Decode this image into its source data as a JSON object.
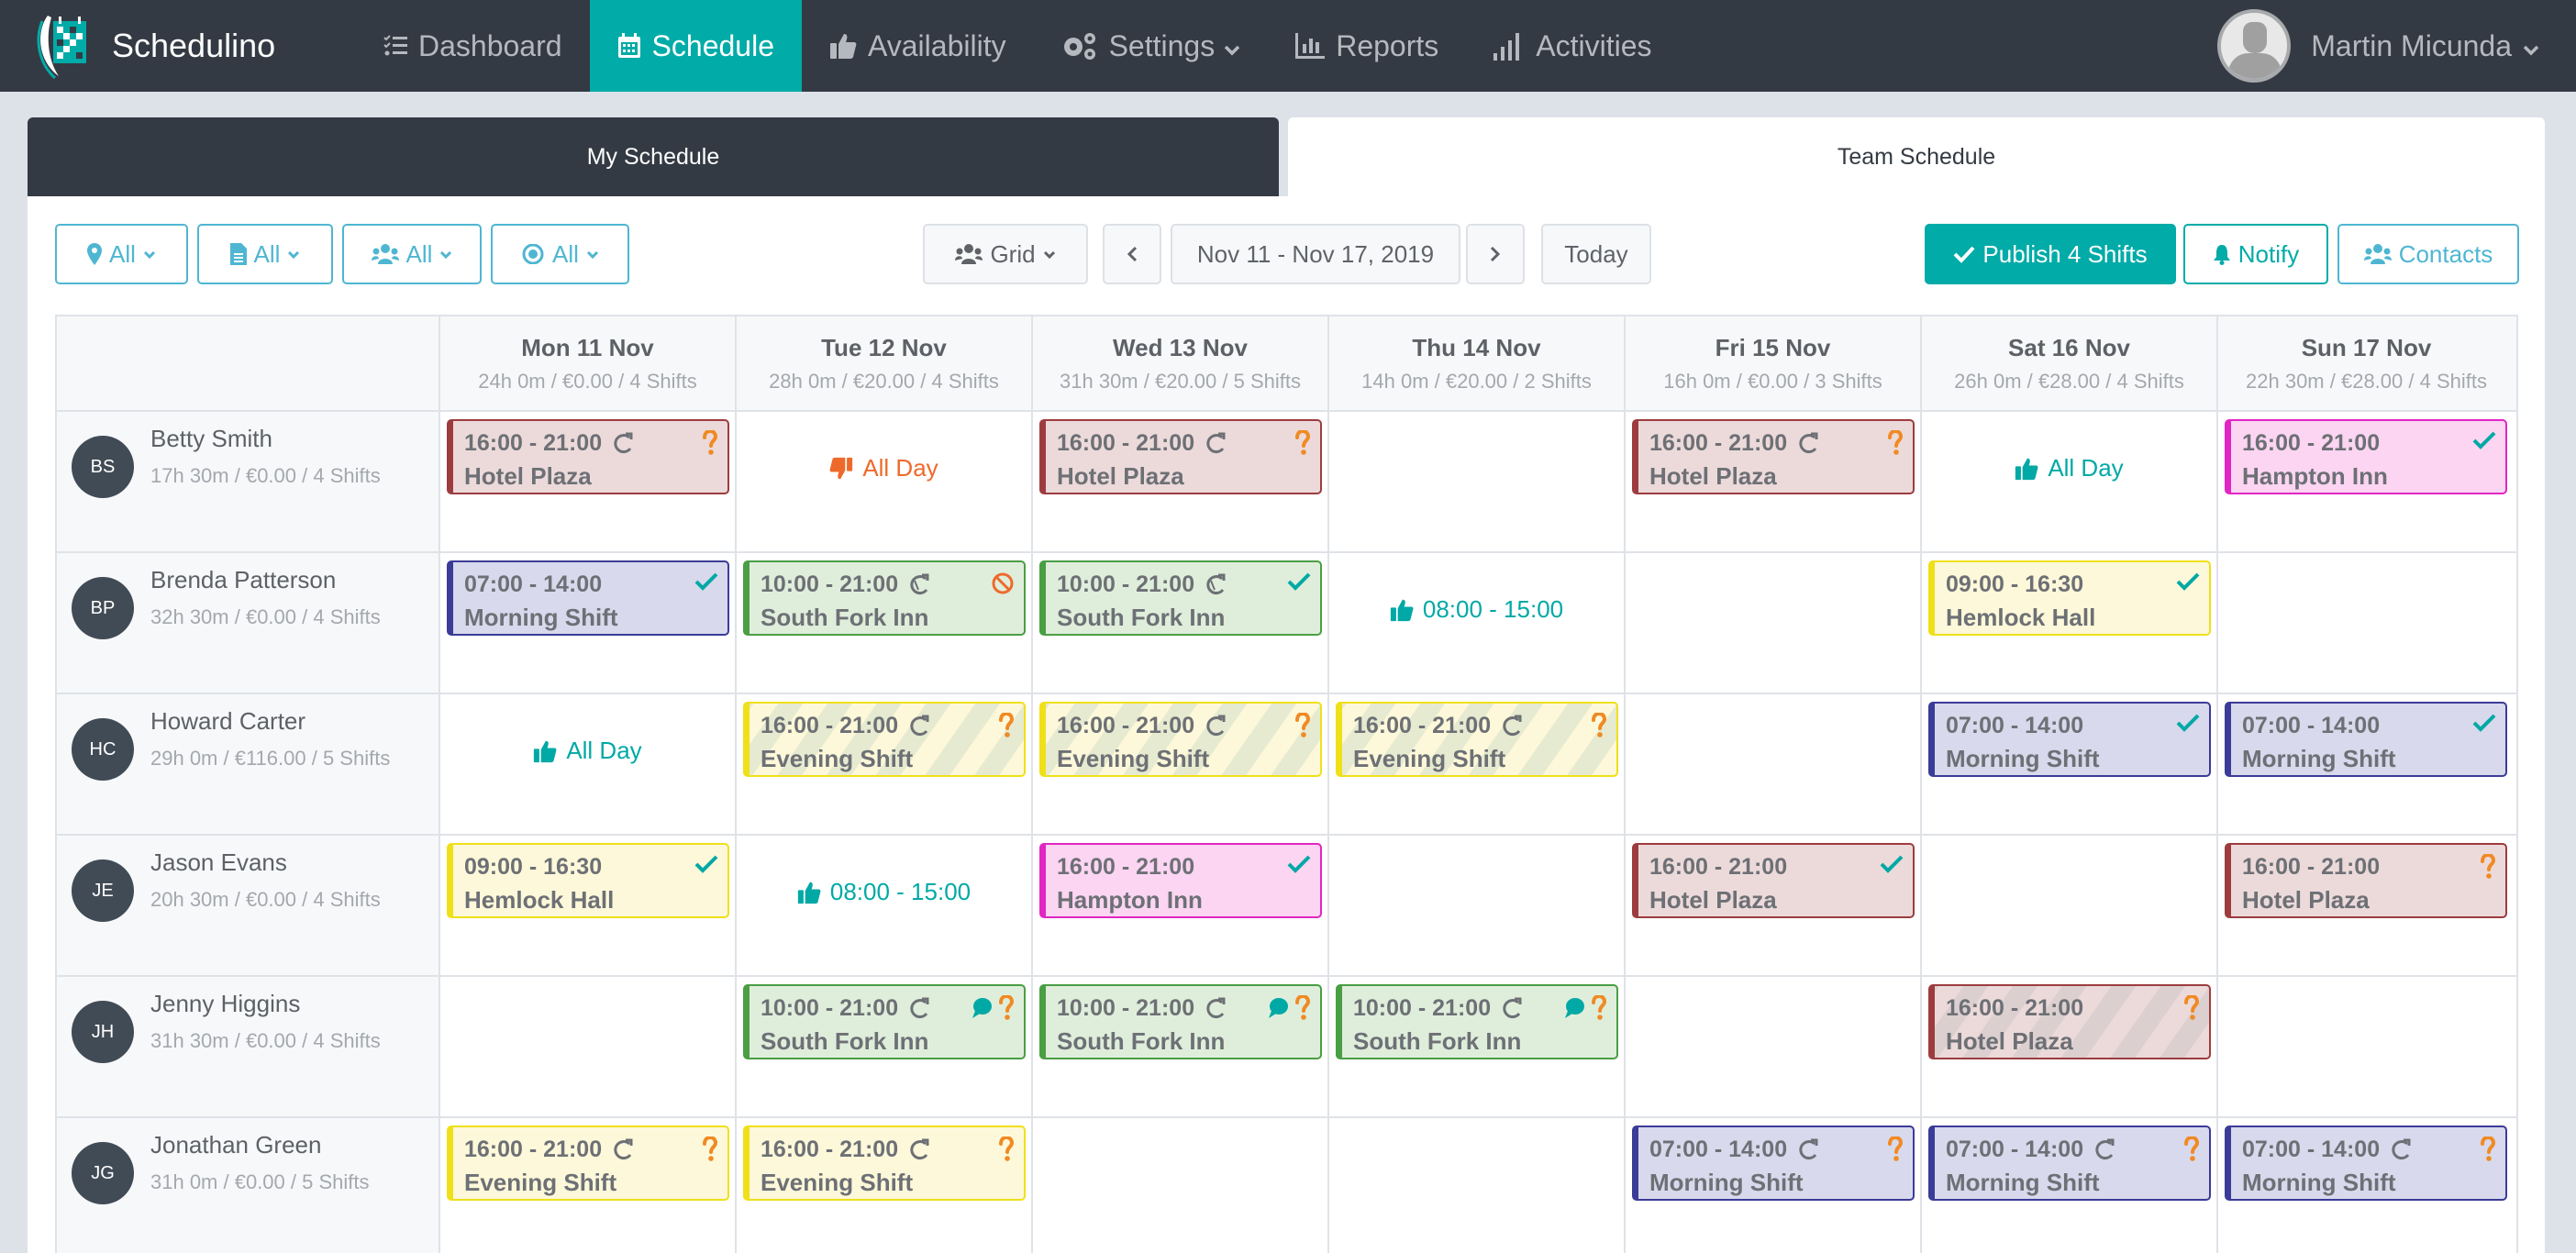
{
  "navbar": {
    "brand": "Schedulino",
    "items": [
      {
        "label": "Dashboard",
        "icon": "tasks-icon",
        "active": false
      },
      {
        "label": "Schedule",
        "icon": "calendar-icon",
        "active": true
      },
      {
        "label": "Availability",
        "icon": "thumbs-up-icon",
        "active": false
      },
      {
        "label": "Settings",
        "icon": "gears-icon",
        "active": false,
        "dropdown": true
      },
      {
        "label": "Reports",
        "icon": "bar-chart-icon",
        "active": false
      },
      {
        "label": "Activities",
        "icon": "signal-icon",
        "active": false
      }
    ],
    "user": "Martin Micunda"
  },
  "tabs": {
    "my_schedule": "My Schedule",
    "team_schedule": "Team Schedule"
  },
  "toolbar": {
    "filters": [
      {
        "icon": "map-marker-icon",
        "label": "All"
      },
      {
        "icon": "file-icon",
        "label": "All"
      },
      {
        "icon": "users-icon",
        "label": "All"
      },
      {
        "icon": "eye-icon",
        "label": "All"
      }
    ],
    "view": "Grid",
    "date_range": "Nov 11 - Nov 17, 2019",
    "today": "Today",
    "publish": "Publish 4 Shifts",
    "notify": "Notify",
    "contacts": "Contacts"
  },
  "colors": {
    "accent": "#00aba8",
    "nav_bg": "#343a43",
    "filter_blue": "#4fb6d2",
    "question_orange": "#f08a24",
    "decline_orange": "#ee6a2a"
  },
  "days": [
    {
      "title": "Mon 11 Nov",
      "summary": "24h 0m / €0.00 / 4 Shifts"
    },
    {
      "title": "Tue 12 Nov",
      "summary": "28h 0m / €20.00 / 4 Shifts"
    },
    {
      "title": "Wed 13 Nov",
      "summary": "31h 30m / €20.00 / 5 Shifts"
    },
    {
      "title": "Thu 14 Nov",
      "summary": "14h 0m / €20.00 / 2 Shifts"
    },
    {
      "title": "Fri 15 Nov",
      "summary": "16h 0m / €0.00 / 3 Shifts"
    },
    {
      "title": "Sat 16 Nov",
      "summary": "26h 0m / €28.00 / 4 Shifts"
    },
    {
      "title": "Sun 17 Nov",
      "summary": "22h 30m / €28.00 / 4 Shifts"
    }
  ],
  "employees": [
    {
      "initials": "BS",
      "name": "Betty Smith",
      "summary": "17h 30m / €0.00 / 4 Shifts",
      "cells": [
        {
          "type": "shift",
          "time": "16:00 - 21:00",
          "location": "Hotel Plaza",
          "color": "red",
          "repeat": true,
          "status": "question"
        },
        {
          "type": "unavailable",
          "label": "All Day"
        },
        {
          "type": "shift",
          "time": "16:00 - 21:00",
          "location": "Hotel Plaza",
          "color": "red",
          "repeat": true,
          "status": "question"
        },
        {
          "type": "empty"
        },
        {
          "type": "shift",
          "time": "16:00 - 21:00",
          "location": "Hotel Plaza",
          "color": "red",
          "repeat": true,
          "status": "question"
        },
        {
          "type": "available",
          "label": "All Day"
        },
        {
          "type": "shift",
          "time": "16:00 - 21:00",
          "location": "Hampton Inn",
          "color": "pink",
          "repeat": false,
          "status": "check"
        }
      ]
    },
    {
      "initials": "BP",
      "name": "Brenda Patterson",
      "summary": "32h 30m / €0.00 / 4 Shifts",
      "cells": [
        {
          "type": "shift",
          "time": "07:00 - 14:00",
          "location": "Morning Shift",
          "color": "blue",
          "repeat": false,
          "status": "check"
        },
        {
          "type": "shift",
          "time": "10:00 - 21:00",
          "location": "South Fork Inn",
          "color": "green",
          "repeat": true,
          "repeat_edited": true,
          "status": "ban"
        },
        {
          "type": "shift",
          "time": "10:00 - 21:00",
          "location": "South Fork Inn",
          "color": "green",
          "repeat": true,
          "repeat_edited": true,
          "status": "check"
        },
        {
          "type": "available",
          "label": "08:00 - 15:00"
        },
        {
          "type": "empty"
        },
        {
          "type": "shift",
          "time": "09:00 - 16:30",
          "location": "Hemlock Hall",
          "color": "yellow",
          "repeat": false,
          "status": "check"
        },
        {
          "type": "empty"
        }
      ]
    },
    {
      "initials": "HC",
      "name": "Howard Carter",
      "summary": "29h 0m / €116.00 / 5 Shifts",
      "cells": [
        {
          "type": "available",
          "label": "All Day"
        },
        {
          "type": "shift",
          "time": "16:00 - 21:00",
          "location": "Evening Shift",
          "color": "yellow",
          "striped": true,
          "repeat": true,
          "status": "question"
        },
        {
          "type": "shift",
          "time": "16:00 - 21:00",
          "location": "Evening Shift",
          "color": "yellow",
          "striped": true,
          "repeat": true,
          "status": "question"
        },
        {
          "type": "shift",
          "time": "16:00 - 21:00",
          "location": "Evening Shift",
          "color": "yellow",
          "striped": true,
          "repeat": true,
          "status": "question"
        },
        {
          "type": "empty"
        },
        {
          "type": "shift",
          "time": "07:00 - 14:00",
          "location": "Morning Shift",
          "color": "blue",
          "repeat": false,
          "status": "check"
        },
        {
          "type": "shift",
          "time": "07:00 - 14:00",
          "location": "Morning Shift",
          "color": "blue",
          "repeat": false,
          "status": "check"
        }
      ]
    },
    {
      "initials": "JE",
      "name": "Jason Evans",
      "summary": "20h 30m / €0.00 / 4 Shifts",
      "cells": [
        {
          "type": "shift",
          "time": "09:00 - 16:30",
          "location": "Hemlock Hall",
          "color": "yellow",
          "repeat": false,
          "status": "check"
        },
        {
          "type": "available",
          "label": "08:00 - 15:00"
        },
        {
          "type": "shift",
          "time": "16:00 - 21:00",
          "location": "Hampton Inn",
          "color": "pink",
          "repeat": false,
          "status": "check"
        },
        {
          "type": "empty"
        },
        {
          "type": "shift",
          "time": "16:00 - 21:00",
          "location": "Hotel Plaza",
          "color": "red",
          "repeat": false,
          "status": "check"
        },
        {
          "type": "empty"
        },
        {
          "type": "shift",
          "time": "16:00 - 21:00",
          "location": "Hotel Plaza",
          "color": "red",
          "repeat": false,
          "status": "question"
        }
      ]
    },
    {
      "initials": "JH",
      "name": "Jenny Higgins",
      "summary": "31h 30m / €0.00 / 4 Shifts",
      "cells": [
        {
          "type": "empty"
        },
        {
          "type": "shift",
          "time": "10:00 - 21:00",
          "location": "South Fork Inn",
          "color": "green",
          "repeat": true,
          "comment": true,
          "status": "question"
        },
        {
          "type": "shift",
          "time": "10:00 - 21:00",
          "location": "South Fork Inn",
          "color": "green",
          "repeat": true,
          "comment": true,
          "status": "question"
        },
        {
          "type": "shift",
          "time": "10:00 - 21:00",
          "location": "South Fork Inn",
          "color": "green",
          "repeat": true,
          "comment": true,
          "status": "question"
        },
        {
          "type": "empty"
        },
        {
          "type": "shift",
          "time": "16:00 - 21:00",
          "location": "Hotel Plaza",
          "color": "red",
          "striped": true,
          "repeat": false,
          "status": "question"
        },
        {
          "type": "empty"
        }
      ]
    },
    {
      "initials": "JG",
      "name": "Jonathan Green",
      "summary": "31h 0m / €0.00 / 5 Shifts",
      "cells": [
        {
          "type": "shift",
          "time": "16:00 - 21:00",
          "location": "Evening Shift",
          "color": "yellow",
          "repeat": true,
          "status": "question"
        },
        {
          "type": "shift",
          "time": "16:00 - 21:00",
          "location": "Evening Shift",
          "color": "yellow",
          "repeat": true,
          "status": "question"
        },
        {
          "type": "empty"
        },
        {
          "type": "empty"
        },
        {
          "type": "shift",
          "time": "07:00 - 14:00",
          "location": "Morning Shift",
          "color": "blue",
          "repeat": true,
          "status": "question"
        },
        {
          "type": "shift",
          "time": "07:00 - 14:00",
          "location": "Morning Shift",
          "color": "blue",
          "repeat": true,
          "status": "question"
        },
        {
          "type": "shift",
          "time": "07:00 - 14:00",
          "location": "Morning Shift",
          "color": "blue",
          "repeat": true,
          "status": "question"
        }
      ]
    }
  ]
}
